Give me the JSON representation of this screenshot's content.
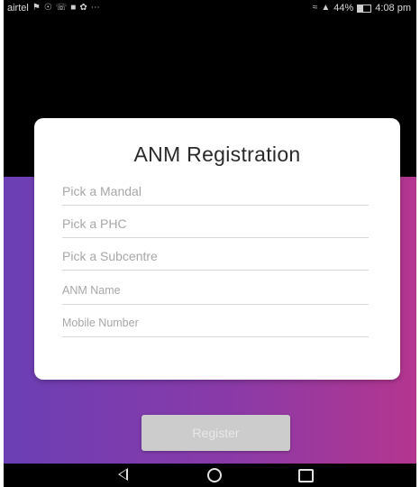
{
  "status_bar": {
    "carrier": "airtel",
    "left_icons": [
      "notification-flag-icon",
      "location-icon",
      "whatsapp-icon",
      "message-icon",
      "app-icon",
      "more-icon"
    ],
    "battery_percent": "44%",
    "time": "4:08 pm"
  },
  "form": {
    "title": "ANM Registration",
    "fields": [
      {
        "placeholder": "Pick a Mandal",
        "type": "dropdown"
      },
      {
        "placeholder": "Pick a PHC",
        "type": "dropdown"
      },
      {
        "placeholder": "Pick a Subcentre",
        "type": "dropdown"
      },
      {
        "placeholder": "ANM Name",
        "type": "text"
      },
      {
        "placeholder": "Mobile Number",
        "type": "text"
      }
    ],
    "register_label": "Register"
  },
  "nav_bar": {
    "icons": [
      "back-icon",
      "home-icon",
      "recents-icon"
    ]
  },
  "colors": {
    "gradient_start": "#6b3fb5",
    "gradient_end": "#b4368f",
    "button_disabled": "#cccccc",
    "card": "#ffffff"
  }
}
